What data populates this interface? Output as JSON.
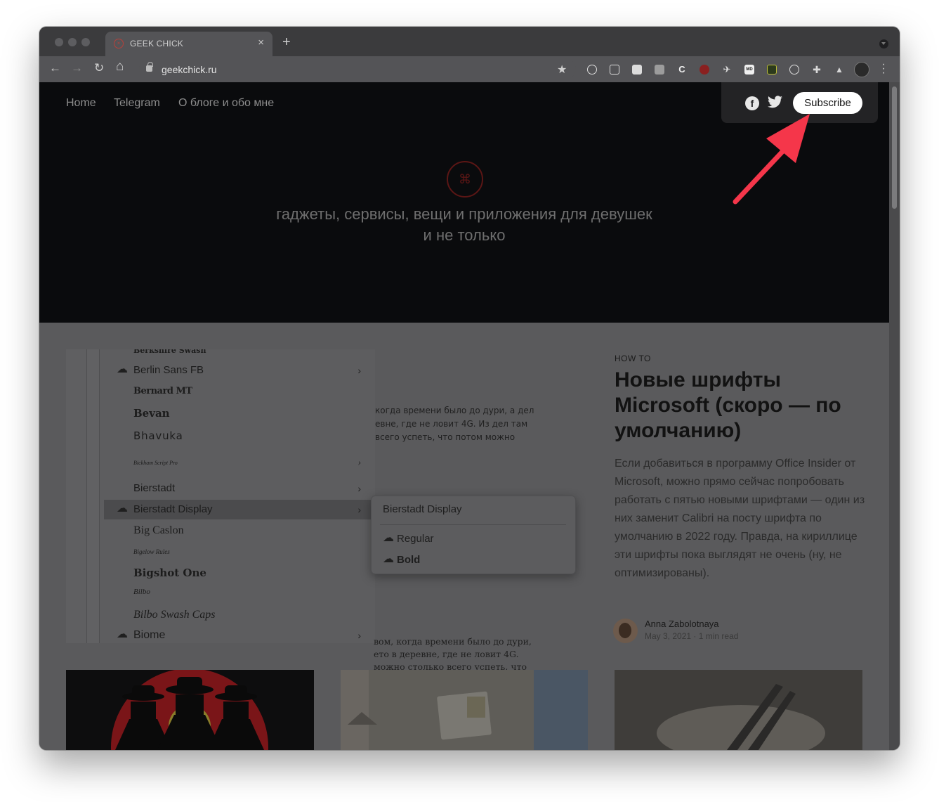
{
  "browser": {
    "tab_title": "GEEK CHICK",
    "tab_close": "×",
    "new_tab": "+",
    "url": "geekchick.ru",
    "back": "←",
    "forward": "→",
    "reload": "↻",
    "home": "⌂",
    "star": "★"
  },
  "site": {
    "nav": [
      "Home",
      "Telegram",
      "О блоге и обо мне"
    ],
    "logo_glyph": "⌘",
    "tagline_line1": "гаджеты, сервисы, вещи и приложения для девушек",
    "tagline_line2": "и не только",
    "subscribe_label": "Subscribe",
    "facebook_glyph": "f"
  },
  "font_menu": {
    "items": [
      {
        "label": "Berkshire Swash"
      },
      {
        "label": "Berlin Sans FB"
      },
      {
        "label": "Bernard MT"
      },
      {
        "label": "Bevan"
      },
      {
        "label": "Bhavuka"
      },
      {
        "label": "Bickham Script Pro"
      },
      {
        "label": "Bierstadt"
      },
      {
        "label": "Bierstadt Display"
      },
      {
        "label": "Big Caslon"
      },
      {
        "label": "Bigelow Rules"
      },
      {
        "label": "Bigshot One"
      },
      {
        "label": "Bilbo"
      },
      {
        "label": "Bilbo Swash Caps"
      },
      {
        "label": "Biome"
      }
    ],
    "submenu_title": "Bierstadt Display",
    "submenu_items": [
      "Regular",
      "Bold"
    ],
    "bg_text_top": [
      "когда времени было до дури, а дел",
      "евне, где не ловит 4G. Из дел там",
      "всего успеть, что потом можно"
    ],
    "bg_text_bottom": [
      "вом, когда времени было до дури,",
      "ето в деревне, где не ловит 4G.",
      "можно столько всего успеть, что"
    ]
  },
  "article": {
    "kicker": "HOW TO",
    "title": "Новые шрифты Microsoft (скоро — по умолчанию)",
    "excerpt": "Если добавиться в программу Office Insider от Microsoft, можно прямо сейчас попробовать работать с пятью новыми шрифтами — один из них заменит Calibri на посту шрифта по умолчанию в 2022 году. Правда, на кириллице эти шрифты пока выглядят не очень (ну, не оптимизированы).",
    "author": "Anna Zabolotnaya",
    "date": "May 3, 2021",
    "read_time": "1 min read",
    "meta_sep": "·"
  },
  "colors": {
    "annotation_arrow": "#f5364a",
    "subscribe_bg": "#ffffff"
  }
}
